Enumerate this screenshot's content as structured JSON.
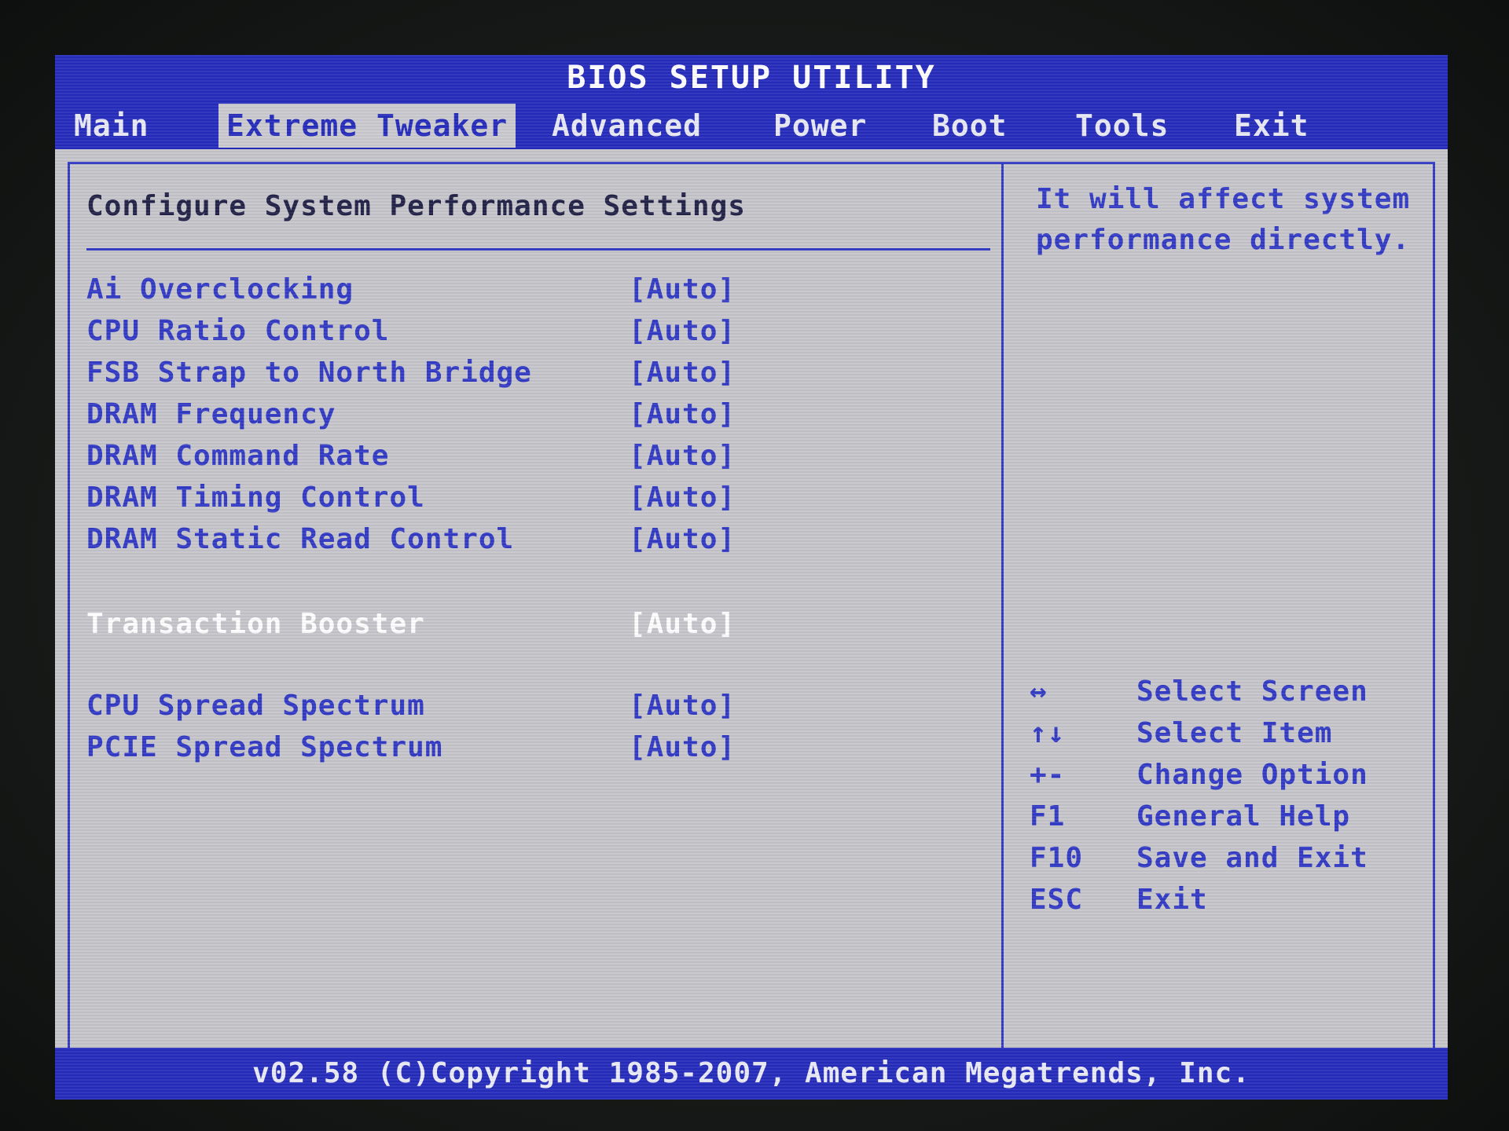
{
  "title": "BIOS SETUP UTILITY",
  "menu": {
    "items": [
      {
        "label": "Main"
      },
      {
        "label": "Extreme Tweaker"
      },
      {
        "label": "Advanced"
      },
      {
        "label": "Power"
      },
      {
        "label": "Boot"
      },
      {
        "label": "Tools"
      },
      {
        "label": "Exit"
      }
    ],
    "active": "Extreme Tweaker"
  },
  "section": {
    "title": "Configure System Performance Settings"
  },
  "settings": [
    {
      "label": "Ai Overclocking",
      "value": "[Auto]"
    },
    {
      "label": "CPU Ratio Control",
      "value": "[Auto]"
    },
    {
      "label": "FSB Strap to North Bridge",
      "value": "[Auto]"
    },
    {
      "label": "DRAM Frequency",
      "value": "[Auto]"
    },
    {
      "label": "DRAM Command Rate",
      "value": "[Auto]"
    },
    {
      "label": "DRAM Timing Control",
      "value": "[Auto]"
    },
    {
      "label": "DRAM Static Read Control",
      "value": "[Auto]"
    },
    {
      "label": "Transaction Booster",
      "value": "[Auto]"
    },
    {
      "label": "CPU Spread Spectrum",
      "value": "[Auto]"
    },
    {
      "label": "PCIE Spread Spectrum",
      "value": "[Auto]"
    }
  ],
  "selected_setting": "Transaction Booster",
  "help": {
    "line1": "It will affect system",
    "line2": "performance directly."
  },
  "keys": [
    {
      "key": "↔",
      "desc": "Select Screen"
    },
    {
      "key": "↑↓",
      "desc": "Select Item"
    },
    {
      "key": "+-",
      "desc": "Change Option"
    },
    {
      "key": "F1",
      "desc": "General Help"
    },
    {
      "key": "F10",
      "desc": "Save and Exit"
    },
    {
      "key": "ESC",
      "desc": "Exit"
    }
  ],
  "footer": "v02.58 (C)Copyright 1985-2007, American Megatrends, Inc.",
  "colors": {
    "bar_blue": "#1d24b8",
    "text_blue": "#2a32c2",
    "panel_gray": "#c4c4c8",
    "selected_text": "#ffffff"
  }
}
